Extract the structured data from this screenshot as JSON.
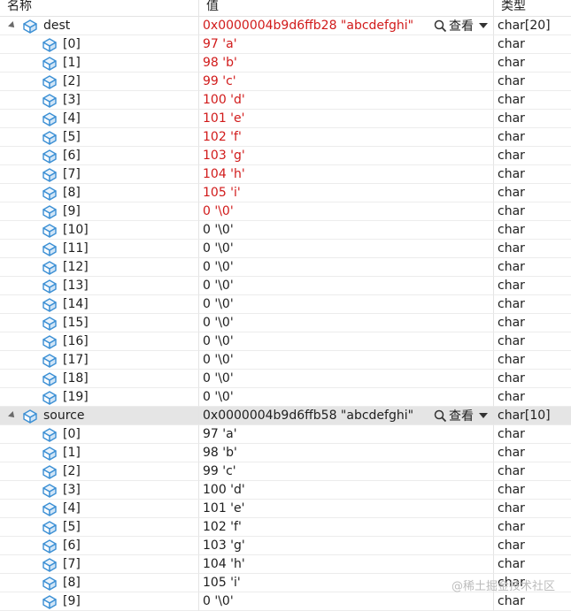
{
  "columns": {
    "name": "名称",
    "value": "值",
    "type": "类型"
  },
  "viewer_label": "查看",
  "watermark": "@稀土掘金技术社区",
  "colors": {
    "changed": "#d11a1a",
    "normal": "#1e1e1e",
    "cube": "#3b8fd4",
    "selected": "#e5e5e5"
  },
  "rows": [
    {
      "name": "dest",
      "value": "0x0000004b9d6ffb28 \"abcdefghi\"",
      "type": "char[20]",
      "level": 0,
      "expanded": true,
      "changed": true,
      "viewer": true,
      "selected": false
    },
    {
      "name": "[0]",
      "value": "97 'a'",
      "type": "char",
      "level": 1,
      "changed": true
    },
    {
      "name": "[1]",
      "value": "98 'b'",
      "type": "char",
      "level": 1,
      "changed": true
    },
    {
      "name": "[2]",
      "value": "99 'c'",
      "type": "char",
      "level": 1,
      "changed": true
    },
    {
      "name": "[3]",
      "value": "100 'd'",
      "type": "char",
      "level": 1,
      "changed": true
    },
    {
      "name": "[4]",
      "value": "101 'e'",
      "type": "char",
      "level": 1,
      "changed": true
    },
    {
      "name": "[5]",
      "value": "102 'f'",
      "type": "char",
      "level": 1,
      "changed": true
    },
    {
      "name": "[6]",
      "value": "103 'g'",
      "type": "char",
      "level": 1,
      "changed": true
    },
    {
      "name": "[7]",
      "value": "104 'h'",
      "type": "char",
      "level": 1,
      "changed": true
    },
    {
      "name": "[8]",
      "value": "105 'i'",
      "type": "char",
      "level": 1,
      "changed": true
    },
    {
      "name": "[9]",
      "value": "0 '\\0'",
      "type": "char",
      "level": 1,
      "changed": true
    },
    {
      "name": "[10]",
      "value": "0 '\\0'",
      "type": "char",
      "level": 1,
      "changed": false
    },
    {
      "name": "[11]",
      "value": "0 '\\0'",
      "type": "char",
      "level": 1,
      "changed": false
    },
    {
      "name": "[12]",
      "value": "0 '\\0'",
      "type": "char",
      "level": 1,
      "changed": false
    },
    {
      "name": "[13]",
      "value": "0 '\\0'",
      "type": "char",
      "level": 1,
      "changed": false
    },
    {
      "name": "[14]",
      "value": "0 '\\0'",
      "type": "char",
      "level": 1,
      "changed": false
    },
    {
      "name": "[15]",
      "value": "0 '\\0'",
      "type": "char",
      "level": 1,
      "changed": false
    },
    {
      "name": "[16]",
      "value": "0 '\\0'",
      "type": "char",
      "level": 1,
      "changed": false
    },
    {
      "name": "[17]",
      "value": "0 '\\0'",
      "type": "char",
      "level": 1,
      "changed": false
    },
    {
      "name": "[18]",
      "value": "0 '\\0'",
      "type": "char",
      "level": 1,
      "changed": false
    },
    {
      "name": "[19]",
      "value": "0 '\\0'",
      "type": "char",
      "level": 1,
      "changed": false
    },
    {
      "name": "source",
      "value": "0x0000004b9d6ffb58 \"abcdefghi\"",
      "type": "char[10]",
      "level": 0,
      "expanded": true,
      "changed": false,
      "viewer": true,
      "selected": true
    },
    {
      "name": "[0]",
      "value": "97 'a'",
      "type": "char",
      "level": 1,
      "changed": false
    },
    {
      "name": "[1]",
      "value": "98 'b'",
      "type": "char",
      "level": 1,
      "changed": false
    },
    {
      "name": "[2]",
      "value": "99 'c'",
      "type": "char",
      "level": 1,
      "changed": false
    },
    {
      "name": "[3]",
      "value": "100 'd'",
      "type": "char",
      "level": 1,
      "changed": false
    },
    {
      "name": "[4]",
      "value": "101 'e'",
      "type": "char",
      "level": 1,
      "changed": false
    },
    {
      "name": "[5]",
      "value": "102 'f'",
      "type": "char",
      "level": 1,
      "changed": false
    },
    {
      "name": "[6]",
      "value": "103 'g'",
      "type": "char",
      "level": 1,
      "changed": false
    },
    {
      "name": "[7]",
      "value": "104 'h'",
      "type": "char",
      "level": 1,
      "changed": false
    },
    {
      "name": "[8]",
      "value": "105 'i'",
      "type": "char",
      "level": 1,
      "changed": false
    },
    {
      "name": "[9]",
      "value": "0 '\\0'",
      "type": "char",
      "level": 1,
      "changed": false
    }
  ]
}
